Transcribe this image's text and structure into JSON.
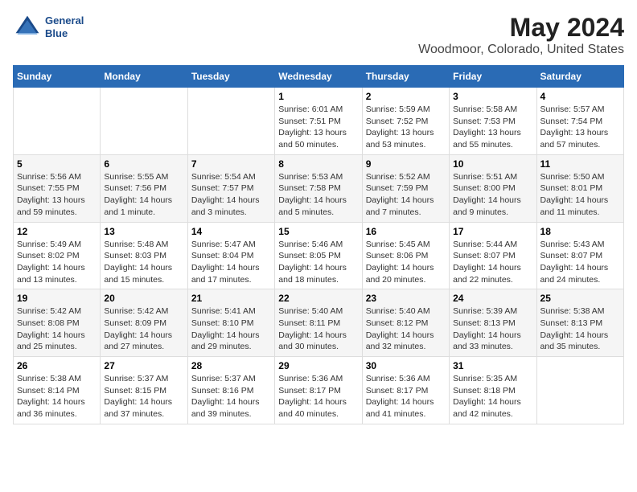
{
  "header": {
    "logo_line1": "General",
    "logo_line2": "Blue",
    "title": "May 2024",
    "subtitle": "Woodmoor, Colorado, United States"
  },
  "columns": [
    "Sunday",
    "Monday",
    "Tuesday",
    "Wednesday",
    "Thursday",
    "Friday",
    "Saturday"
  ],
  "weeks": [
    [
      {
        "day": "",
        "info": ""
      },
      {
        "day": "",
        "info": ""
      },
      {
        "day": "",
        "info": ""
      },
      {
        "day": "1",
        "info": "Sunrise: 6:01 AM\nSunset: 7:51 PM\nDaylight: 13 hours\nand 50 minutes."
      },
      {
        "day": "2",
        "info": "Sunrise: 5:59 AM\nSunset: 7:52 PM\nDaylight: 13 hours\nand 53 minutes."
      },
      {
        "day": "3",
        "info": "Sunrise: 5:58 AM\nSunset: 7:53 PM\nDaylight: 13 hours\nand 55 minutes."
      },
      {
        "day": "4",
        "info": "Sunrise: 5:57 AM\nSunset: 7:54 PM\nDaylight: 13 hours\nand 57 minutes."
      }
    ],
    [
      {
        "day": "5",
        "info": "Sunrise: 5:56 AM\nSunset: 7:55 PM\nDaylight: 13 hours\nand 59 minutes."
      },
      {
        "day": "6",
        "info": "Sunrise: 5:55 AM\nSunset: 7:56 PM\nDaylight: 14 hours\nand 1 minute."
      },
      {
        "day": "7",
        "info": "Sunrise: 5:54 AM\nSunset: 7:57 PM\nDaylight: 14 hours\nand 3 minutes."
      },
      {
        "day": "8",
        "info": "Sunrise: 5:53 AM\nSunset: 7:58 PM\nDaylight: 14 hours\nand 5 minutes."
      },
      {
        "day": "9",
        "info": "Sunrise: 5:52 AM\nSunset: 7:59 PM\nDaylight: 14 hours\nand 7 minutes."
      },
      {
        "day": "10",
        "info": "Sunrise: 5:51 AM\nSunset: 8:00 PM\nDaylight: 14 hours\nand 9 minutes."
      },
      {
        "day": "11",
        "info": "Sunrise: 5:50 AM\nSunset: 8:01 PM\nDaylight: 14 hours\nand 11 minutes."
      }
    ],
    [
      {
        "day": "12",
        "info": "Sunrise: 5:49 AM\nSunset: 8:02 PM\nDaylight: 14 hours\nand 13 minutes."
      },
      {
        "day": "13",
        "info": "Sunrise: 5:48 AM\nSunset: 8:03 PM\nDaylight: 14 hours\nand 15 minutes."
      },
      {
        "day": "14",
        "info": "Sunrise: 5:47 AM\nSunset: 8:04 PM\nDaylight: 14 hours\nand 17 minutes."
      },
      {
        "day": "15",
        "info": "Sunrise: 5:46 AM\nSunset: 8:05 PM\nDaylight: 14 hours\nand 18 minutes."
      },
      {
        "day": "16",
        "info": "Sunrise: 5:45 AM\nSunset: 8:06 PM\nDaylight: 14 hours\nand 20 minutes."
      },
      {
        "day": "17",
        "info": "Sunrise: 5:44 AM\nSunset: 8:07 PM\nDaylight: 14 hours\nand 22 minutes."
      },
      {
        "day": "18",
        "info": "Sunrise: 5:43 AM\nSunset: 8:07 PM\nDaylight: 14 hours\nand 24 minutes."
      }
    ],
    [
      {
        "day": "19",
        "info": "Sunrise: 5:42 AM\nSunset: 8:08 PM\nDaylight: 14 hours\nand 25 minutes."
      },
      {
        "day": "20",
        "info": "Sunrise: 5:42 AM\nSunset: 8:09 PM\nDaylight: 14 hours\nand 27 minutes."
      },
      {
        "day": "21",
        "info": "Sunrise: 5:41 AM\nSunset: 8:10 PM\nDaylight: 14 hours\nand 29 minutes."
      },
      {
        "day": "22",
        "info": "Sunrise: 5:40 AM\nSunset: 8:11 PM\nDaylight: 14 hours\nand 30 minutes."
      },
      {
        "day": "23",
        "info": "Sunrise: 5:40 AM\nSunset: 8:12 PM\nDaylight: 14 hours\nand 32 minutes."
      },
      {
        "day": "24",
        "info": "Sunrise: 5:39 AM\nSunset: 8:13 PM\nDaylight: 14 hours\nand 33 minutes."
      },
      {
        "day": "25",
        "info": "Sunrise: 5:38 AM\nSunset: 8:13 PM\nDaylight: 14 hours\nand 35 minutes."
      }
    ],
    [
      {
        "day": "26",
        "info": "Sunrise: 5:38 AM\nSunset: 8:14 PM\nDaylight: 14 hours\nand 36 minutes."
      },
      {
        "day": "27",
        "info": "Sunrise: 5:37 AM\nSunset: 8:15 PM\nDaylight: 14 hours\nand 37 minutes."
      },
      {
        "day": "28",
        "info": "Sunrise: 5:37 AM\nSunset: 8:16 PM\nDaylight: 14 hours\nand 39 minutes."
      },
      {
        "day": "29",
        "info": "Sunrise: 5:36 AM\nSunset: 8:17 PM\nDaylight: 14 hours\nand 40 minutes."
      },
      {
        "day": "30",
        "info": "Sunrise: 5:36 AM\nSunset: 8:17 PM\nDaylight: 14 hours\nand 41 minutes."
      },
      {
        "day": "31",
        "info": "Sunrise: 5:35 AM\nSunset: 8:18 PM\nDaylight: 14 hours\nand 42 minutes."
      },
      {
        "day": "",
        "info": ""
      }
    ]
  ]
}
